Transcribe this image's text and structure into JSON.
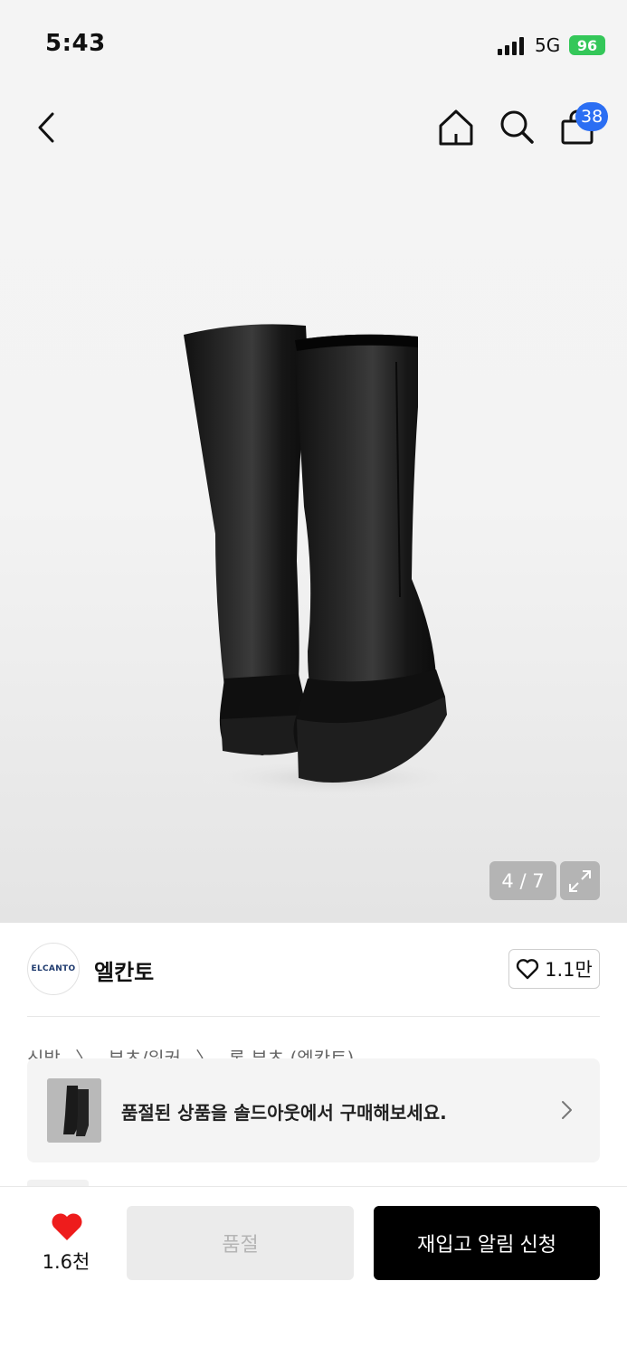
{
  "status_bar": {
    "time": "5:43",
    "network": "5G",
    "battery": "96",
    "battery_color": "#34c759"
  },
  "nav": {
    "back_icon": "chevron-left-icon",
    "home_icon": "home-icon",
    "search_icon": "search-icon",
    "cart_icon": "shopping-bag-icon",
    "cart_count": "38",
    "badge_color": "#2b6ef3"
  },
  "gallery": {
    "counter": "4 / 7",
    "expand_icon": "expand-icon"
  },
  "brand": {
    "logo_text": "ELCANTO",
    "name": "엘칸토",
    "like_count": "1.1만"
  },
  "breadcrumb": [
    "신발",
    "〉",
    "부츠/워커",
    "〉",
    "롱 부츠 (엘칸토)"
  ],
  "soldout_banner": {
    "text": "품절된 상품을 솔드아웃에서 구매해보세요."
  },
  "bottom_bar": {
    "wish_count": "1.6천",
    "heart_color": "#ee1c1c",
    "soldout_label": "품절",
    "notify_label": "재입고 알림 신청"
  }
}
